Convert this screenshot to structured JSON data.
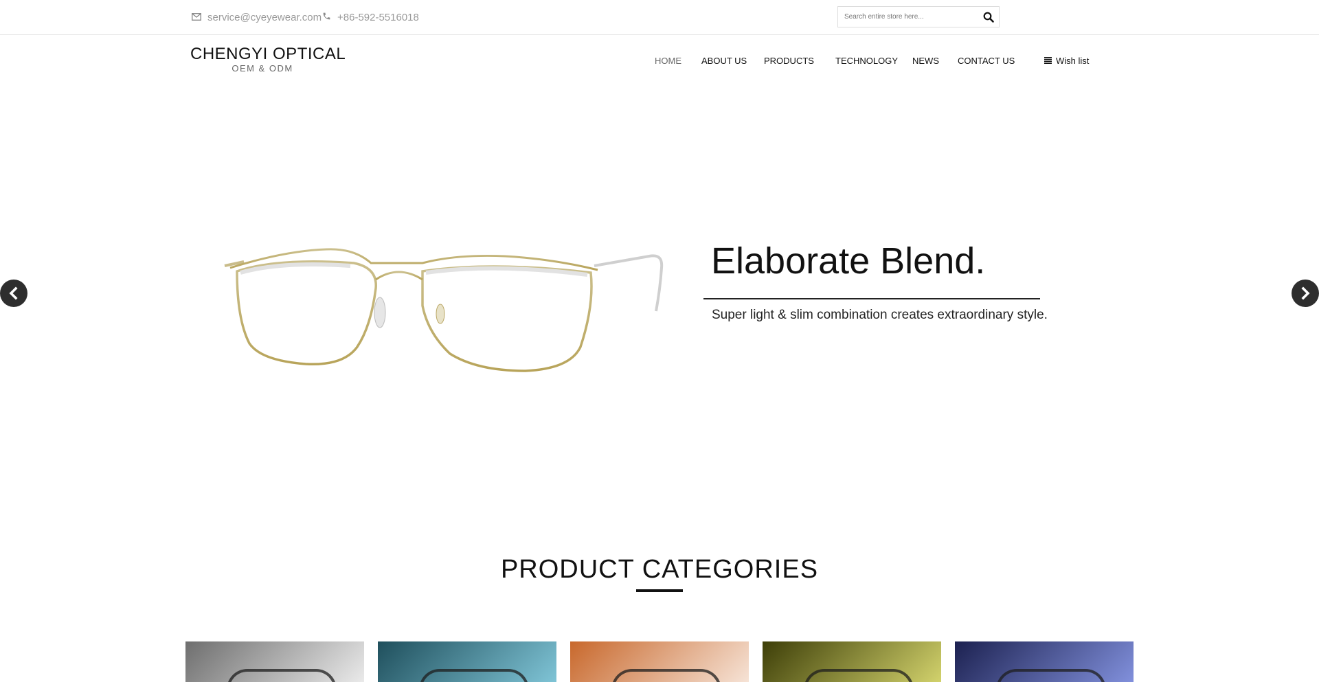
{
  "topbar": {
    "email": "service@cyeyewear.com",
    "phone": "+86-592-5516018",
    "search_placeholder": "Search entire store here..."
  },
  "logo": {
    "main": "CHENGYI OPTICAL",
    "sub": "OEM & ODM"
  },
  "nav": {
    "items": [
      "HOME",
      "ABOUT US",
      "PRODUCTS",
      "TECHNOLOGY",
      "NEWS",
      "CONTACT US"
    ],
    "active": "HOME",
    "wishlist": "Wish list"
  },
  "slider": {
    "headline": "Elaborate Blend.",
    "tagline": "Super light & slim combination creates extraordinary style."
  },
  "categories": {
    "title": "PRODUCT CATEGORIES",
    "cards": [
      {
        "bg": "linear-gradient(135deg,#6e6e6e,#eaeaea)"
      },
      {
        "bg": "linear-gradient(135deg,#1f4f5c,#7fc4d6)"
      },
      {
        "bg": "linear-gradient(135deg,#c8682c,#f6e3d6)"
      },
      {
        "bg": "linear-gradient(135deg,#3d3e08,#d2d26c)"
      },
      {
        "bg": "linear-gradient(135deg,#1c2150,#8190dc)"
      }
    ]
  },
  "colors": {
    "arrow": "#2e2e2e",
    "text": "#111111",
    "muted": "#9a9a9a"
  },
  "icons": {
    "email": "envelope-icon",
    "phone": "phone-icon",
    "search": "magnifier-icon",
    "wishlist": "list-icon",
    "prev": "chevron-left-icon",
    "next": "chevron-right-icon"
  }
}
